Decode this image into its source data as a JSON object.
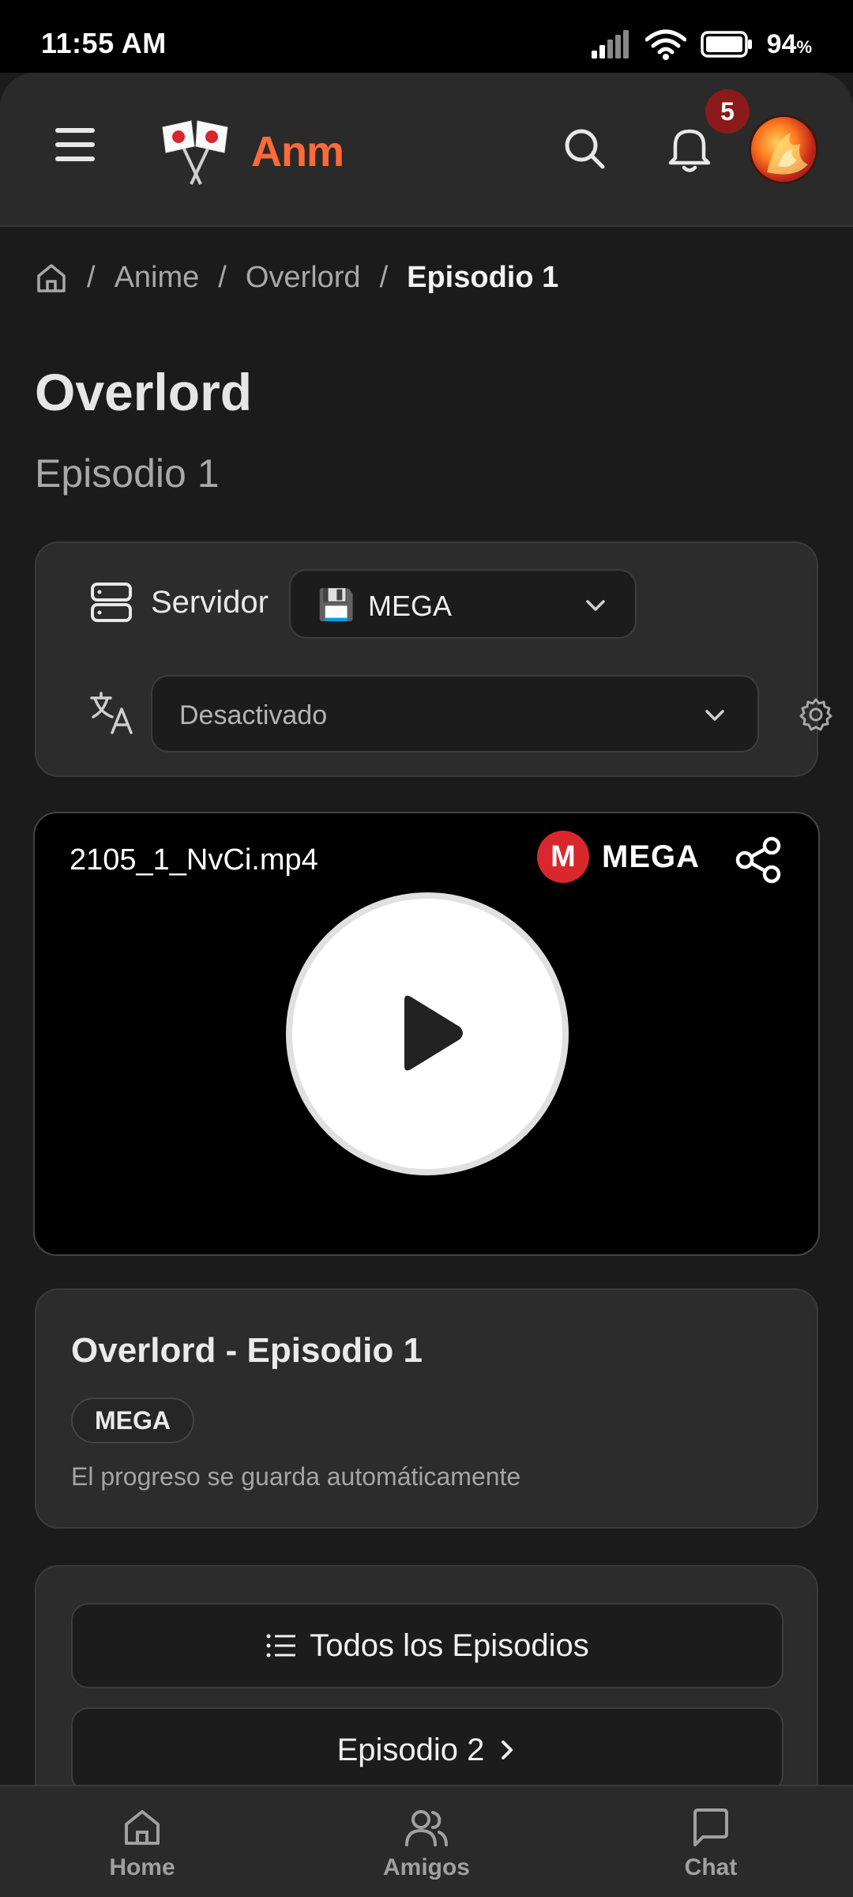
{
  "status_bar": {
    "time": "11:55 AM",
    "battery": "94",
    "battery_unit": "%"
  },
  "header": {
    "logo_text": "Anm",
    "notification_count": "5"
  },
  "breadcrumb": {
    "items": [
      "Anime",
      "Overlord"
    ],
    "separator": "/",
    "current": "Episodio 1"
  },
  "page": {
    "title": "Overlord",
    "subtitle": "Episodio 1"
  },
  "server": {
    "label": "Servidor",
    "selected": "MEGA",
    "subtitles_selected": "Desactivado"
  },
  "player": {
    "file_name": "2105_1_NvCi.mp4",
    "brand_letter": "M",
    "brand_name": "MEGA"
  },
  "info": {
    "title": "Overlord - Episodio 1",
    "badge": "MEGA",
    "note": "El progreso se guarda automáticamente"
  },
  "episodes": {
    "all_label": "Todos los Episodios",
    "next_label": "Episodio 2"
  },
  "bottom_nav": {
    "items": [
      {
        "label": "Home"
      },
      {
        "label": "Amigos"
      },
      {
        "label": "Chat"
      }
    ]
  },
  "colors": {
    "accent": "#ff6a3a",
    "badge": "#8b1a1a",
    "mega_red": "#d9272e",
    "background": "#1b1b1b",
    "card": "#2c2c2c"
  }
}
